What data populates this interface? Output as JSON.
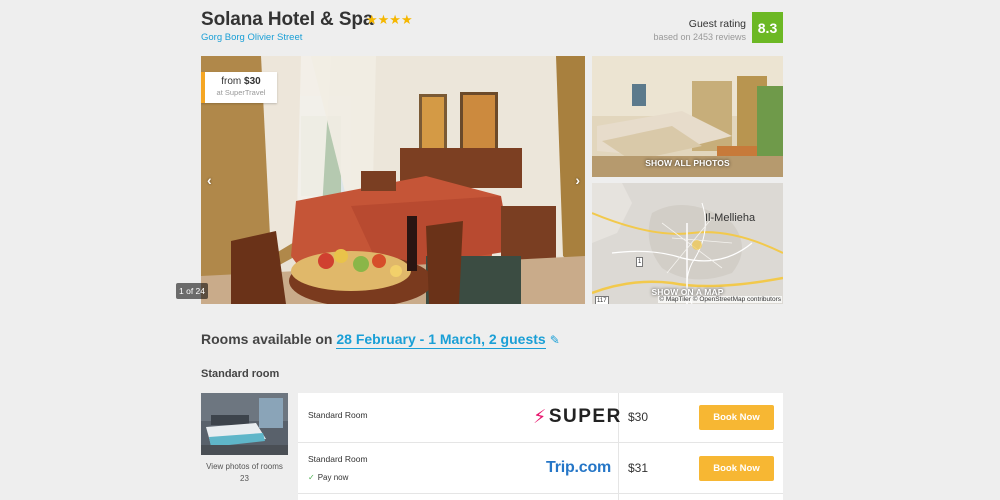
{
  "hotel": {
    "name": "Solana Hotel & Spa",
    "stars": "★★★★",
    "address": "Gorg Borg Olivier Street",
    "rating_label": "Guest rating",
    "rating_reviews": "based on 2453 reviews",
    "rating_score": "8.3"
  },
  "gallery": {
    "price_from_prefix": "from ",
    "price_from_value": "$30",
    "price_seller": "at SuperTravel",
    "prev_arrow": "‹",
    "next_arrow": "›",
    "counter": "1 of 24",
    "show_all_label": "SHOW ALL PHOTOS"
  },
  "map": {
    "town": "Il-Mellieha",
    "show_label": "SHOW ON A MAP",
    "credit": "© MapTiler © OpenStreetMap contributors",
    "road_1": "1",
    "road_117": "117"
  },
  "rooms": {
    "title_prefix": "Rooms available on ",
    "dates": "28 February - 1 March, 2 guests",
    "edit_icon": "✎",
    "room_type": "Standard room",
    "view_photos": "View photos of rooms 23",
    "offers": [
      {
        "room": "Standard Room",
        "provider": "SUPER",
        "provider_mark": "⚡",
        "price": "$30",
        "book_label": "Book Now"
      },
      {
        "room": "Standard Room",
        "pay_now": "Pay now",
        "pay_check": "✓",
        "provider": "Trip.com",
        "price": "$31",
        "book_label": "Book Now"
      }
    ]
  },
  "colors": {
    "accent_blue": "#1a9fd6",
    "rating_green": "#6cb824",
    "book_orange": "#f7b733",
    "star_gold": "#f5b700"
  }
}
